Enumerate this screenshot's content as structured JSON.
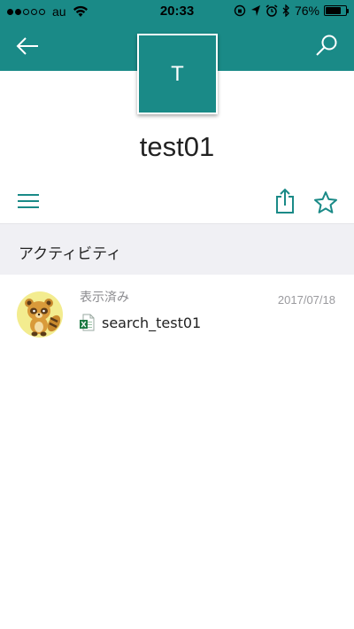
{
  "status_bar": {
    "carrier": "au",
    "time": "20:33",
    "battery_percent": "76%",
    "battery_level": 0.76,
    "signal_bars_filled": 2,
    "signal_bars_total": 5
  },
  "header": {
    "back_icon": "arrow-left-icon",
    "search_icon": "search-icon",
    "avatar_letter": "T",
    "title": "test01",
    "accent_color": "#1a8a87"
  },
  "actions": {
    "menu_icon": "hamburger-menu-icon",
    "share_icon": "share-icon",
    "favorite_icon": "star-icon"
  },
  "activity": {
    "section_title": "アクティビティ",
    "items": [
      {
        "action": "表示済み",
        "date": "2017/07/18",
        "file_name": "search_test01",
        "file_type_icon": "excel-file-icon",
        "avatar_icon": "tanuki-avatar-icon"
      }
    ]
  }
}
